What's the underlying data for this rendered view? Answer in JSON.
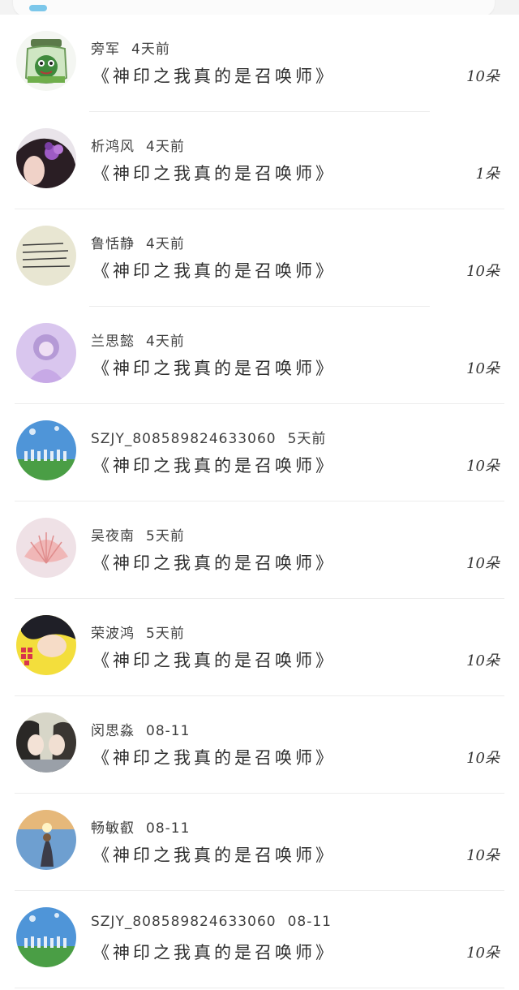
{
  "colors": {
    "accent": "#7cc7ea",
    "text": "#333333",
    "divider": "#ececec"
  },
  "entries": [
    {
      "name": "旁军",
      "time": "4天前",
      "gift": "《神印之我真的是召唤师》",
      "count": "10朵",
      "avatar": "jar-frog-avatar"
    },
    {
      "name": "析鸿风",
      "time": "4天前",
      "gift": "《神印之我真的是召唤师》",
      "count": "1朵",
      "avatar": "girl-purple-flower-avatar"
    },
    {
      "name": "鲁恬静",
      "time": "4天前",
      "gift": "《神印之我真的是召唤师》",
      "count": "10朵",
      "avatar": "handwritten-note-avatar"
    },
    {
      "name": "兰思懿",
      "time": "4天前",
      "gift": "《神印之我真的是召唤师》",
      "count": "10朵",
      "avatar": "purple-girl-avatar"
    },
    {
      "name": "SZJY_808589824633060",
      "time": "5天前",
      "gift": "《神印之我真的是召唤师》",
      "count": "10朵",
      "avatar": "group-sky-avatar"
    },
    {
      "name": "吴夜南",
      "time": "5天前",
      "gift": "《神印之我真的是召唤师》",
      "count": "10朵",
      "avatar": "shell-avatar"
    },
    {
      "name": "荣波鸿",
      "time": "5天前",
      "gift": "《神印之我真的是召唤师》",
      "count": "10朵",
      "avatar": "anime-boy-yellow-avatar"
    },
    {
      "name": "闵思淼",
      "time": "08-11",
      "gift": "《神印之我真的是召唤师》",
      "count": "10朵",
      "avatar": "anime-couple-avatar"
    },
    {
      "name": "畅敏叡",
      "time": "08-11",
      "gift": "《神印之我真的是召唤师》",
      "count": "10朵",
      "avatar": "sea-sunset-avatar"
    },
    {
      "name": "SZJY_808589824633060",
      "time": "08-11",
      "gift": "《神印之我真的是召唤师》",
      "count": "10朵",
      "avatar": "group-sky-avatar"
    }
  ]
}
